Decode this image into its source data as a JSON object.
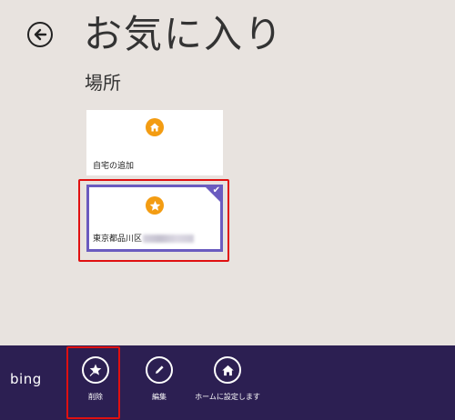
{
  "header": {
    "title": "お気に入り"
  },
  "section": {
    "title": "場所"
  },
  "tiles": [
    {
      "label": "自宅の追加",
      "icon": "home-icon",
      "selected": false
    },
    {
      "label": "東京都品川区",
      "icon": "star-icon",
      "selected": true
    }
  ],
  "app_bar": {
    "brand": "bing",
    "buttons": [
      {
        "label": "削除",
        "icon": "remove-favorite-icon"
      },
      {
        "label": "編集",
        "icon": "pencil-icon"
      },
      {
        "label": "ホームに設定します",
        "icon": "home-icon"
      }
    ]
  },
  "colors": {
    "background": "#e8e3df",
    "app_bar": "#2c1f52",
    "accent_selected": "#6a5bbf",
    "tile_icon": "#f39c12",
    "highlight_frame": "#e01010"
  }
}
